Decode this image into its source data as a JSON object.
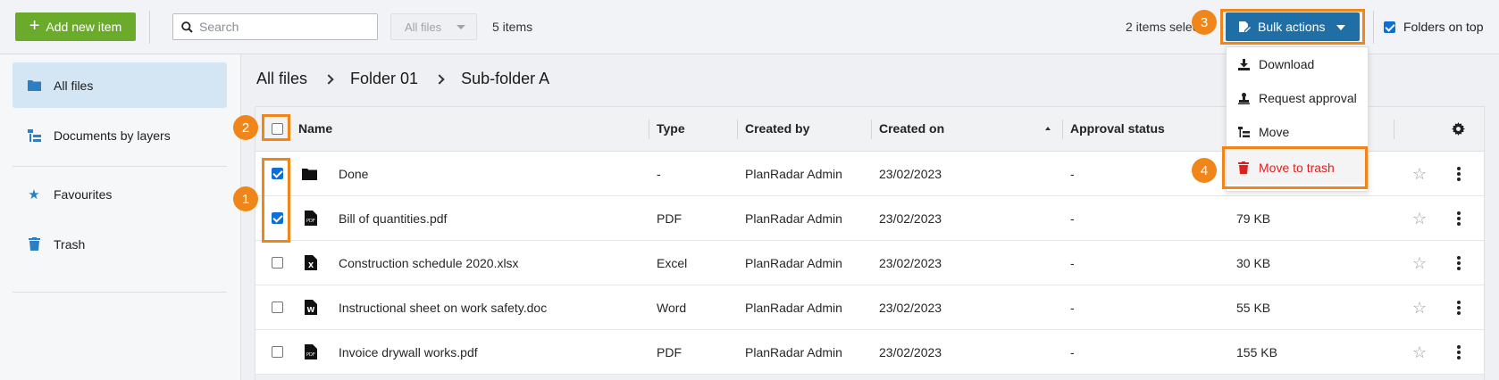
{
  "topbar": {
    "add_label": "Add new item",
    "search_placeholder": "Search",
    "filter_selected": "All files",
    "items_count": "5 items",
    "selected_text": "2 items selected",
    "bulk_label": "Bulk actions",
    "folders_on_top_label": "Folders on top",
    "folders_on_top_checked": true
  },
  "badges": [
    "1",
    "2",
    "3",
    "4"
  ],
  "sidebar": {
    "items": [
      {
        "label": "All files",
        "icon": "folder-icon",
        "active": true
      },
      {
        "label": "Documents by layers",
        "icon": "layers-icon",
        "active": false
      },
      {
        "label": "Favourites",
        "icon": "star-icon",
        "active": false
      },
      {
        "label": "Trash",
        "icon": "trash-icon",
        "active": false
      }
    ]
  },
  "breadcrumb": [
    "All files",
    "Folder 01",
    "Sub-folder A"
  ],
  "table": {
    "columns": [
      "Name",
      "Type",
      "Created by",
      "Created on",
      "Approval status"
    ],
    "rows": [
      {
        "name": "Done",
        "type": "-",
        "created_by": "PlanRadar Admin",
        "created_on": "23/02/2023",
        "approval": "-",
        "size": "",
        "checked": true,
        "icon": "folder-icon"
      },
      {
        "name": "Bill of quantities.pdf",
        "type": "PDF",
        "created_by": "PlanRadar Admin",
        "created_on": "23/02/2023",
        "approval": "-",
        "size": "79 KB",
        "checked": true,
        "icon": "pdf-file-icon"
      },
      {
        "name": "Construction schedule 2020.xlsx",
        "type": "Excel",
        "created_by": "PlanRadar Admin",
        "created_on": "23/02/2023",
        "approval": "-",
        "size": "30 KB",
        "checked": false,
        "icon": "excel-file-icon"
      },
      {
        "name": "Instructional sheet on work safety.doc",
        "type": "Word",
        "created_by": "PlanRadar Admin",
        "created_on": "23/02/2023",
        "approval": "-",
        "size": "55 KB",
        "checked": false,
        "icon": "word-file-icon"
      },
      {
        "name": "Invoice drywall works.pdf",
        "type": "PDF",
        "created_by": "PlanRadar Admin",
        "created_on": "23/02/2023",
        "approval": "-",
        "size": "155 KB",
        "checked": false,
        "icon": "pdf-file-icon"
      }
    ]
  },
  "dropdown": {
    "items": [
      {
        "label": "Download",
        "icon": "download-icon"
      },
      {
        "label": "Request approval",
        "icon": "stamp-icon"
      },
      {
        "label": "Move",
        "icon": "move-icon"
      },
      {
        "label": "Move to trash",
        "icon": "trash-icon"
      }
    ]
  },
  "colors": {
    "add_button": "#6bab2c",
    "bulk_button": "#1f6fa6",
    "highlight": "#f08619",
    "danger": "#e02020",
    "sidebar_active": "#d4e5f4"
  }
}
